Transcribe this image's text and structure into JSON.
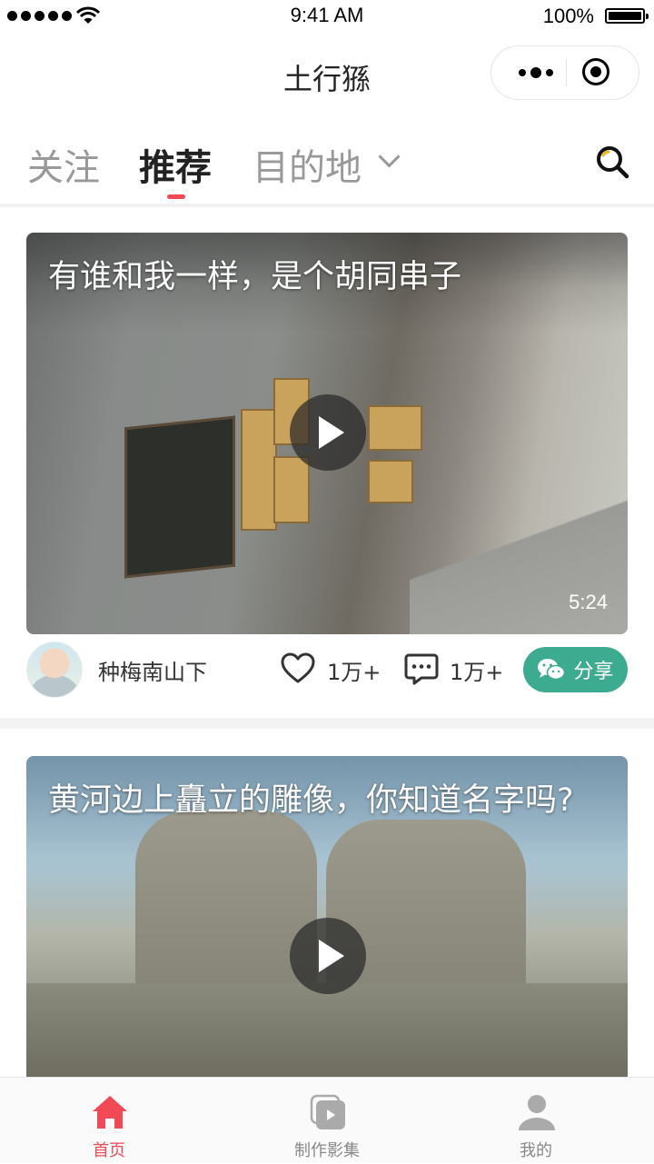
{
  "status_bar": {
    "time": "9:41 AM",
    "battery": "100%"
  },
  "nav": {
    "title": "土行猻"
  },
  "tabs": [
    {
      "label": "关注",
      "active": false
    },
    {
      "label": "推荐",
      "active": true
    },
    {
      "label": "目的地",
      "active": false
    }
  ],
  "feed": [
    {
      "title": "有谁和我一样，是个胡同串子",
      "duration": "5:24",
      "author": "种梅南山下",
      "likes": "1万+",
      "comments": "1万+",
      "share_label": "分享"
    },
    {
      "title": "黄河边上矗立的雕像，你知道名字吗?"
    }
  ],
  "tabbar": [
    {
      "label": "首页",
      "icon": "home-icon",
      "active": true
    },
    {
      "label": "制作影集",
      "icon": "album-icon",
      "active": false
    },
    {
      "label": "我的",
      "icon": "user-icon",
      "active": false
    }
  ],
  "colors": {
    "accent": "#f24957",
    "share": "#3dab90",
    "inactive": "#999999"
  }
}
